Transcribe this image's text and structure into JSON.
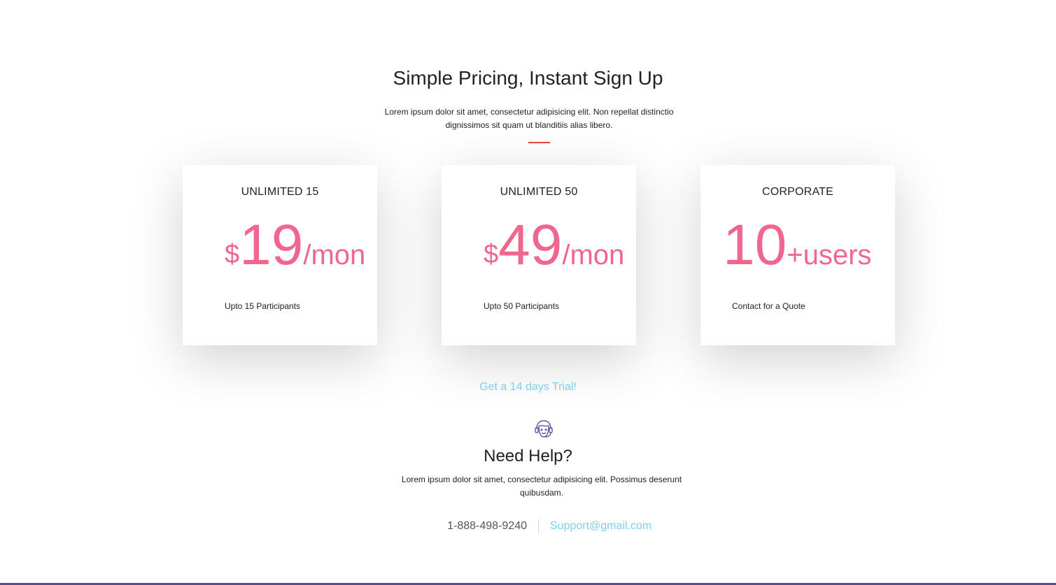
{
  "header": {
    "title": "Simple Pricing, Instant Sign Up",
    "subtitle": "Lorem ipsum dolor sit amet, consectetur adipisicing elit. Non repellat distinctio dignissimos sit quam ut blanditiis alias libero."
  },
  "plans": [
    {
      "name": "UNLIMITED 15",
      "currency": "$",
      "amount": "19",
      "suffix": "/mon",
      "feature": "Upto 15 Participants"
    },
    {
      "name": "UNLIMITED 50",
      "currency": "$",
      "amount": "49",
      "suffix": "/mon",
      "feature": "Upto 50 Participants"
    },
    {
      "name": "CORPORATE",
      "currency": "",
      "amount": "10",
      "suffix": "+users",
      "feature": "Contact for a Quote"
    }
  ],
  "trial": {
    "label": "Get a 14 days Trial!"
  },
  "help": {
    "icon": "support-agent-icon",
    "title": "Need Help?",
    "text": "Lorem ipsum dolor sit amet, consectetur adipisicing elit. Possimus deserunt quibusdam.",
    "phone": "1-888-498-9240",
    "email": "Support@gmail.com"
  },
  "colors": {
    "accent_pink": "#f0668f",
    "link_blue": "#7dcff0",
    "divider_red": "#e8453c",
    "bottom_bar": "#5a4a9c",
    "icon_purple": "#6a4fa0"
  }
}
